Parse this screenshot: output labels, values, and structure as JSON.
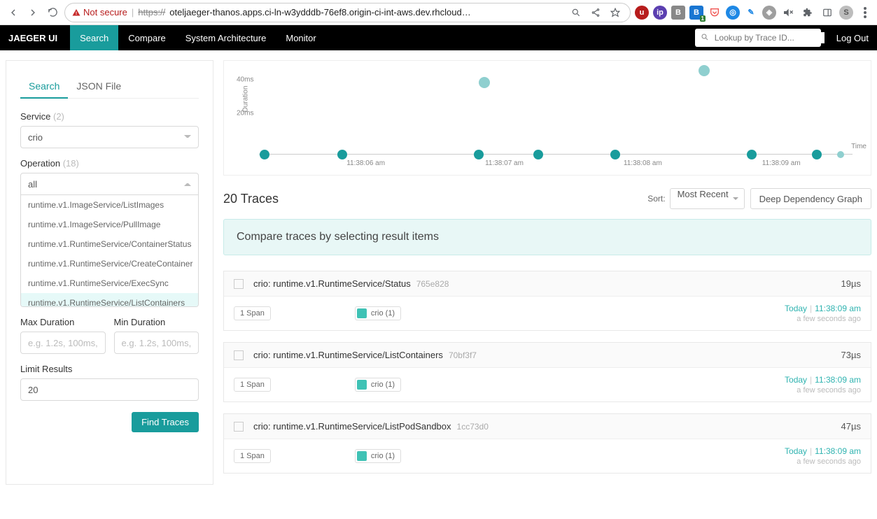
{
  "browser": {
    "not_secure": "Not secure",
    "url_scheme_host": "https://",
    "url_rest": "oteljaeger-thanos.apps.ci-ln-w3ydddb-76ef8.origin-ci-int-aws.dev.rhcloud…",
    "avatar_letter": "S",
    "ext_b2_badge": "1"
  },
  "header": {
    "logo": "JAEGER UI",
    "tabs": [
      "Search",
      "Compare",
      "System Architecture",
      "Monitor"
    ],
    "active_tab": 0,
    "lookup_placeholder": "Lookup by Trace ID...",
    "logout": "Log Out"
  },
  "sidebar": {
    "tabs": [
      "Search",
      "JSON File"
    ],
    "active_tab": 0,
    "service": {
      "label": "Service",
      "count": "(2)",
      "value": "crio"
    },
    "operation": {
      "label": "Operation",
      "count": "(18)",
      "value": "all",
      "options": [
        "runtime.v1.ImageService/ListImages",
        "runtime.v1.ImageService/PullImage",
        "runtime.v1.RuntimeService/ContainerStatus",
        "runtime.v1.RuntimeService/CreateContainer",
        "runtime.v1.RuntimeService/ExecSync",
        "runtime.v1.RuntimeService/ListContainers"
      ],
      "selected_index": 5
    },
    "max_dur": {
      "label": "Max Duration",
      "placeholder": "e.g. 1.2s, 100ms, 500"
    },
    "min_dur": {
      "label": "Min Duration",
      "placeholder": "e.g. 1.2s, 100ms, 500"
    },
    "limit": {
      "label": "Limit Results",
      "value": "20"
    },
    "find_btn": "Find Traces"
  },
  "results": {
    "count_label": "20 Traces",
    "sort_label": "Sort:",
    "sort_value": "Most Recent",
    "ddg_btn": "Deep Dependency Graph",
    "banner": "Compare traces by selecting result items",
    "traces": [
      {
        "name": "crio: runtime.v1.RuntimeService/Status",
        "id": "765e828",
        "dur": "19µs",
        "spans": "1 Span",
        "svc": "crio (1)",
        "day": "Today",
        "time": "11:38:09 am",
        "ago": "a few seconds ago"
      },
      {
        "name": "crio: runtime.v1.RuntimeService/ListContainers",
        "id": "70bf3f7",
        "dur": "73µs",
        "spans": "1 Span",
        "svc": "crio (1)",
        "day": "Today",
        "time": "11:38:09 am",
        "ago": "a few seconds ago"
      },
      {
        "name": "crio: runtime.v1.RuntimeService/ListPodSandbox",
        "id": "1cc73d0",
        "dur": "47µs",
        "spans": "1 Span",
        "svc": "crio (1)",
        "day": "Today",
        "time": "11:38:09 am",
        "ago": "a few seconds ago"
      }
    ]
  },
  "chart_data": {
    "type": "scatter",
    "xlabel": "Time",
    "ylabel": "Duration",
    "y_ticks": [
      "20ms",
      "40ms"
    ],
    "ylim_ms": [
      0,
      50
    ],
    "x_ticks": [
      "11:38:06 am",
      "11:38:07 am",
      "11:38:08 am",
      "11:38:09 am"
    ],
    "points": [
      {
        "x_pct": 1,
        "y_ms": 0,
        "size": "md"
      },
      {
        "x_pct": 14,
        "y_ms": 0,
        "size": "md"
      },
      {
        "x_pct": 37,
        "y_ms": 0,
        "size": "md"
      },
      {
        "x_pct": 38,
        "y_ms": 43,
        "size": "lg"
      },
      {
        "x_pct": 47,
        "y_ms": 0,
        "size": "md"
      },
      {
        "x_pct": 60,
        "y_ms": 0,
        "size": "md"
      },
      {
        "x_pct": 75,
        "y_ms": 50,
        "size": "lg"
      },
      {
        "x_pct": 83,
        "y_ms": 0,
        "size": "md"
      },
      {
        "x_pct": 94,
        "y_ms": 0,
        "size": "md"
      },
      {
        "x_pct": 98,
        "y_ms": 0,
        "size": "sm"
      }
    ]
  }
}
